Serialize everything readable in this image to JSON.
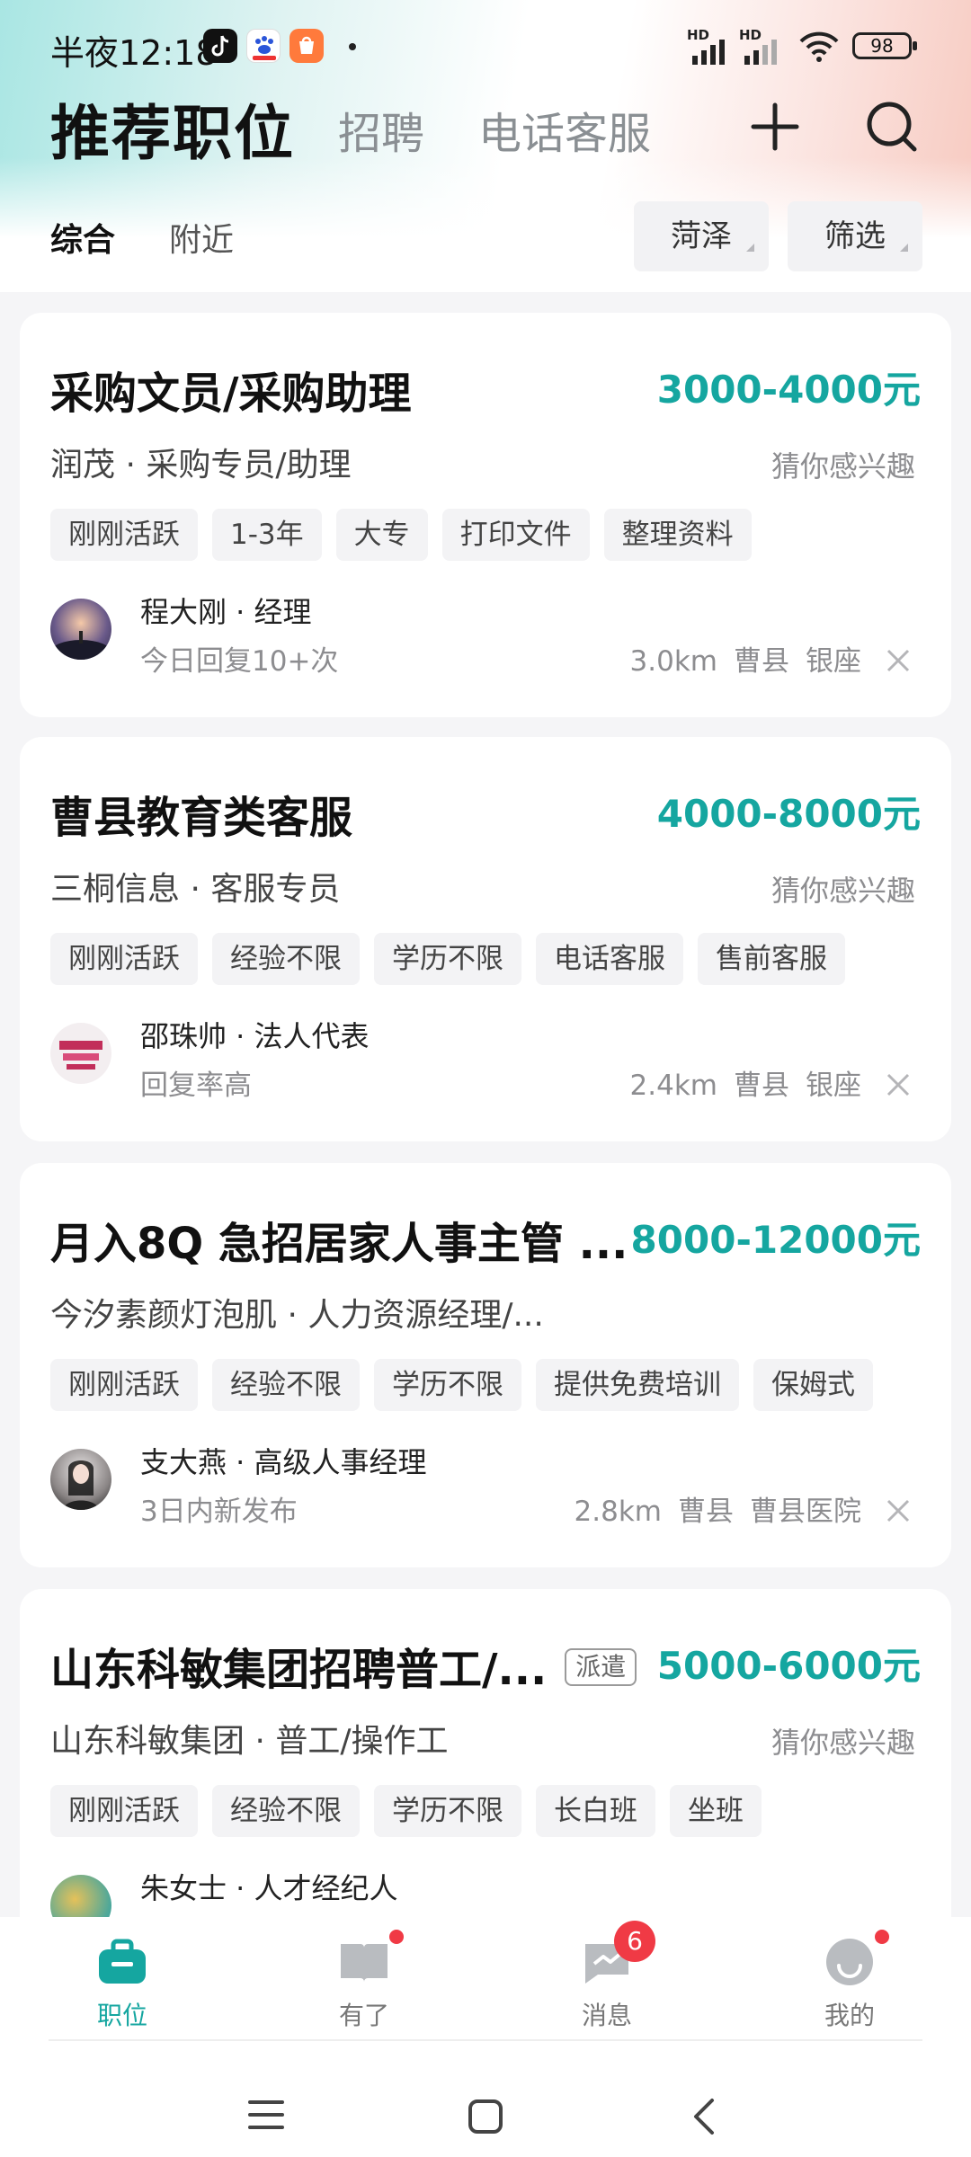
{
  "status_bar": {
    "time": "半夜12:18",
    "battery": "98",
    "network_hd": "HD"
  },
  "header": {
    "title": "推荐职位",
    "tabs": [
      "招聘",
      "电话客服"
    ]
  },
  "subnav": {
    "items": [
      "综合",
      "附近"
    ],
    "city_filter": "菏泽",
    "filter_label": "筛选"
  },
  "jobs": [
    {
      "title": "采购文员/采购助理",
      "salary": "3000-4000元",
      "company": "润茂 · 采购专员/助理",
      "interest": "猜你感兴趣",
      "tags": [
        "刚刚活跃",
        "1-3年",
        "大专",
        "打印文件",
        "整理资料"
      ],
      "recruiter": "程大刚 · 经理",
      "reply": "今日回复10+次",
      "distance": "3.0km",
      "district": "曹县",
      "area": "银座"
    },
    {
      "title": "曹县教育类客服",
      "salary": "4000-8000元",
      "company": "三桐信息 · 客服专员",
      "interest": "猜你感兴趣",
      "tags": [
        "刚刚活跃",
        "经验不限",
        "学历不限",
        "电话客服",
        "售前客服"
      ],
      "recruiter": "邵珠帅 · 法人代表",
      "reply": "回复率高",
      "distance": "2.4km",
      "district": "曹县",
      "area": "银座"
    },
    {
      "title": "月入8Q 急招居家人事主管 ...",
      "salary": "8000-12000元",
      "company": "今汐素颜灯泡肌 · 人力资源经理/...",
      "interest": "",
      "tags": [
        "刚刚活跃",
        "经验不限",
        "学历不限",
        "提供免费培训",
        "保姆式"
      ],
      "recruiter": "支大燕 · 高级人事经理",
      "reply": "3日内新发布",
      "distance": "2.8km",
      "district": "曹县",
      "area": "曹县医院"
    },
    {
      "title": "山东科敏集团招聘普工/...",
      "badge": "派遣",
      "salary": "5000-6000元",
      "company": "山东科敏集团 · 普工/操作工",
      "interest": "猜你感兴趣",
      "tags": [
        "刚刚活跃",
        "经验不限",
        "学历不限",
        "长白班",
        "坐班"
      ],
      "recruiter": "朱女士 · 人才经纪人"
    }
  ],
  "bottom_nav": {
    "items": [
      "职位",
      "有了",
      "消息",
      "我的"
    ],
    "message_badge": "6"
  },
  "colors": {
    "accent": "#15a6a0",
    "badge_red": "#f03a45"
  }
}
